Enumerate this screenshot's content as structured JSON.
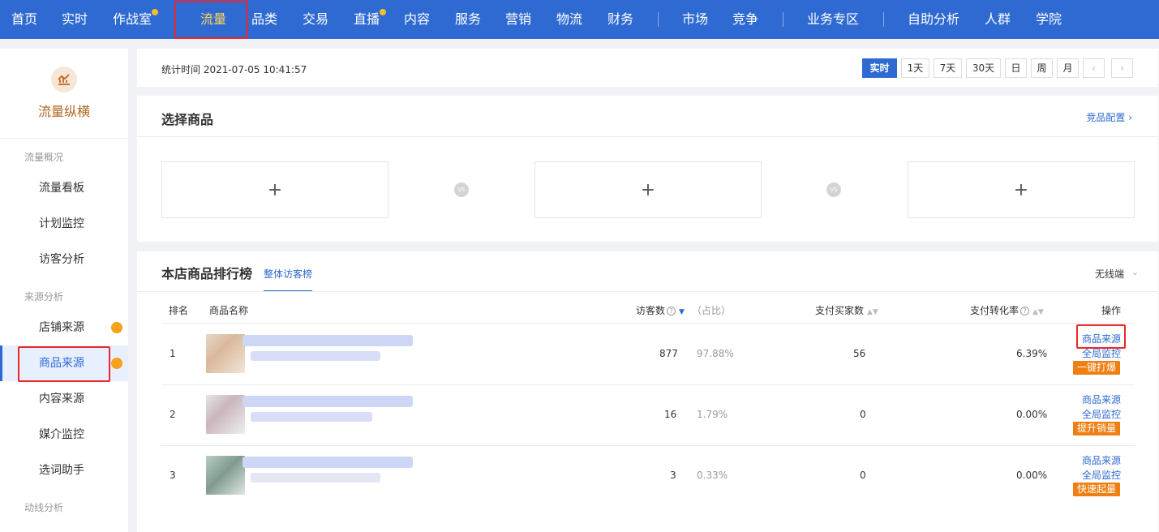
{
  "topnav": {
    "items": [
      {
        "label": "首页"
      },
      {
        "label": "实时"
      },
      {
        "label": "作战室"
      },
      {
        "label": "流量"
      },
      {
        "label": "品类"
      },
      {
        "label": "交易"
      },
      {
        "label": "直播"
      },
      {
        "label": "内容"
      },
      {
        "label": "服务"
      },
      {
        "label": "营销"
      },
      {
        "label": "物流"
      },
      {
        "label": "财务"
      },
      {
        "label": "市场"
      },
      {
        "label": "竞争"
      },
      {
        "label": "业务专区"
      },
      {
        "label": "自助分析"
      },
      {
        "label": "人群"
      },
      {
        "label": "学院"
      }
    ],
    "active": "流量"
  },
  "sidebar": {
    "title": "流量纵横",
    "groups": [
      "流量概况",
      "来源分析",
      "动线分析"
    ],
    "items": [
      {
        "label": "流量看板"
      },
      {
        "label": "计划监控"
      },
      {
        "label": "访客分析"
      },
      {
        "label": "店铺来源"
      },
      {
        "label": "商品来源"
      },
      {
        "label": "内容来源"
      },
      {
        "label": "媒介监控"
      },
      {
        "label": "选词助手"
      }
    ],
    "active": "商品来源"
  },
  "timebar": {
    "label": "统计时间 2021-07-05 10:41:57",
    "buttons": [
      "实时",
      "1天",
      "7天",
      "30天",
      "日",
      "周",
      "月"
    ],
    "active": "实时",
    "prev": "‹",
    "next": "›"
  },
  "select_card": {
    "title": "选择商品",
    "config_link": "竞品配置 ›",
    "slot_plus": "+",
    "vs_label": "VS"
  },
  "ranking": {
    "title": "本店商品排行榜",
    "tab": "整体访客榜",
    "device": "无线端",
    "headers": {
      "rank": "排名",
      "name": "商品名称",
      "visitors": "访客数",
      "share": "（占比）",
      "buyers": "支付买家数",
      "conv": "支付转化率",
      "ops": "操作"
    },
    "rows": [
      {
        "rank": "1",
        "visitors": "877",
        "share": "97.88%",
        "buyers": "56",
        "conv": "6.39%",
        "op1": "商品来源",
        "op2": "全局监控",
        "badge": "一键打爆"
      },
      {
        "rank": "2",
        "visitors": "16",
        "share": "1.79%",
        "buyers": "0",
        "conv": "0.00%",
        "op1": "商品来源",
        "op2": "全局监控",
        "badge": "提升销量"
      },
      {
        "rank": "3",
        "visitors": "3",
        "share": "0.33%",
        "buyers": "0",
        "conv": "0.00%",
        "op1": "商品来源",
        "op2": "全局监控",
        "badge": "快速起量"
      }
    ]
  },
  "colors": {
    "nav_bg": "#2e6ad1",
    "accent": "#2e6ad1",
    "active_nav": "#ffd45c",
    "badge": "#f07f13",
    "highlight_box": "#e8292b"
  }
}
